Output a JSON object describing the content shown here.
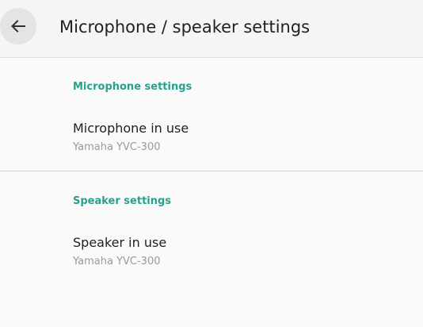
{
  "appbar": {
    "back_icon": "arrow-back-icon",
    "title": "Microphone / speaker settings"
  },
  "sections": [
    {
      "header": "Microphone settings",
      "item_title": "Microphone in use",
      "item_summary": "Yamaha YVC-300"
    },
    {
      "header": "Speaker settings",
      "item_title": "Speaker in use",
      "item_summary": "Yamaha YVC-300"
    }
  ],
  "colors": {
    "accent": "#26a18f",
    "primary_text": "#212121",
    "secondary_text": "#9a9a9a",
    "background": "#fafafa"
  }
}
